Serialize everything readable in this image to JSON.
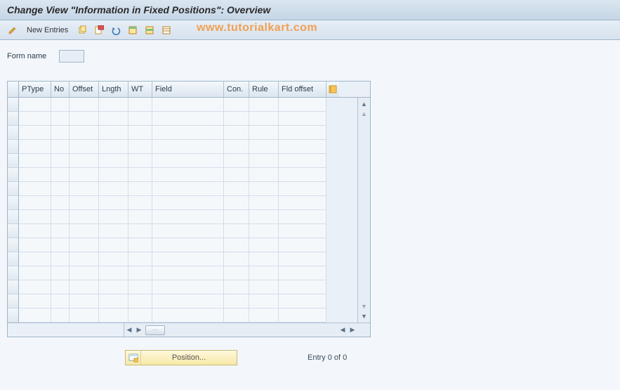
{
  "title": "Change View \"Information in Fixed Positions\": Overview",
  "toolbar": {
    "pencil_icon": "pencil-icon",
    "new_entries": "New Entries",
    "copy_icon": "copy-icon",
    "delete_icon": "delete-icon",
    "undo_icon": "undo-icon",
    "select_all_icon": "select-all-icon",
    "select_block_icon": "select-block-icon",
    "deselect_icon": "deselect-icon"
  },
  "watermark": "www.tutorialkart.com",
  "form": {
    "label": "Form name",
    "value": ""
  },
  "table": {
    "columns": [
      "PType",
      "No",
      "Offset",
      "Lngth",
      "WT",
      "Field",
      "Con.",
      "Rule",
      "Fld offset"
    ],
    "rows_visible": 16
  },
  "footer": {
    "position_btn": "Position...",
    "entry_text": "Entry 0 of 0"
  }
}
